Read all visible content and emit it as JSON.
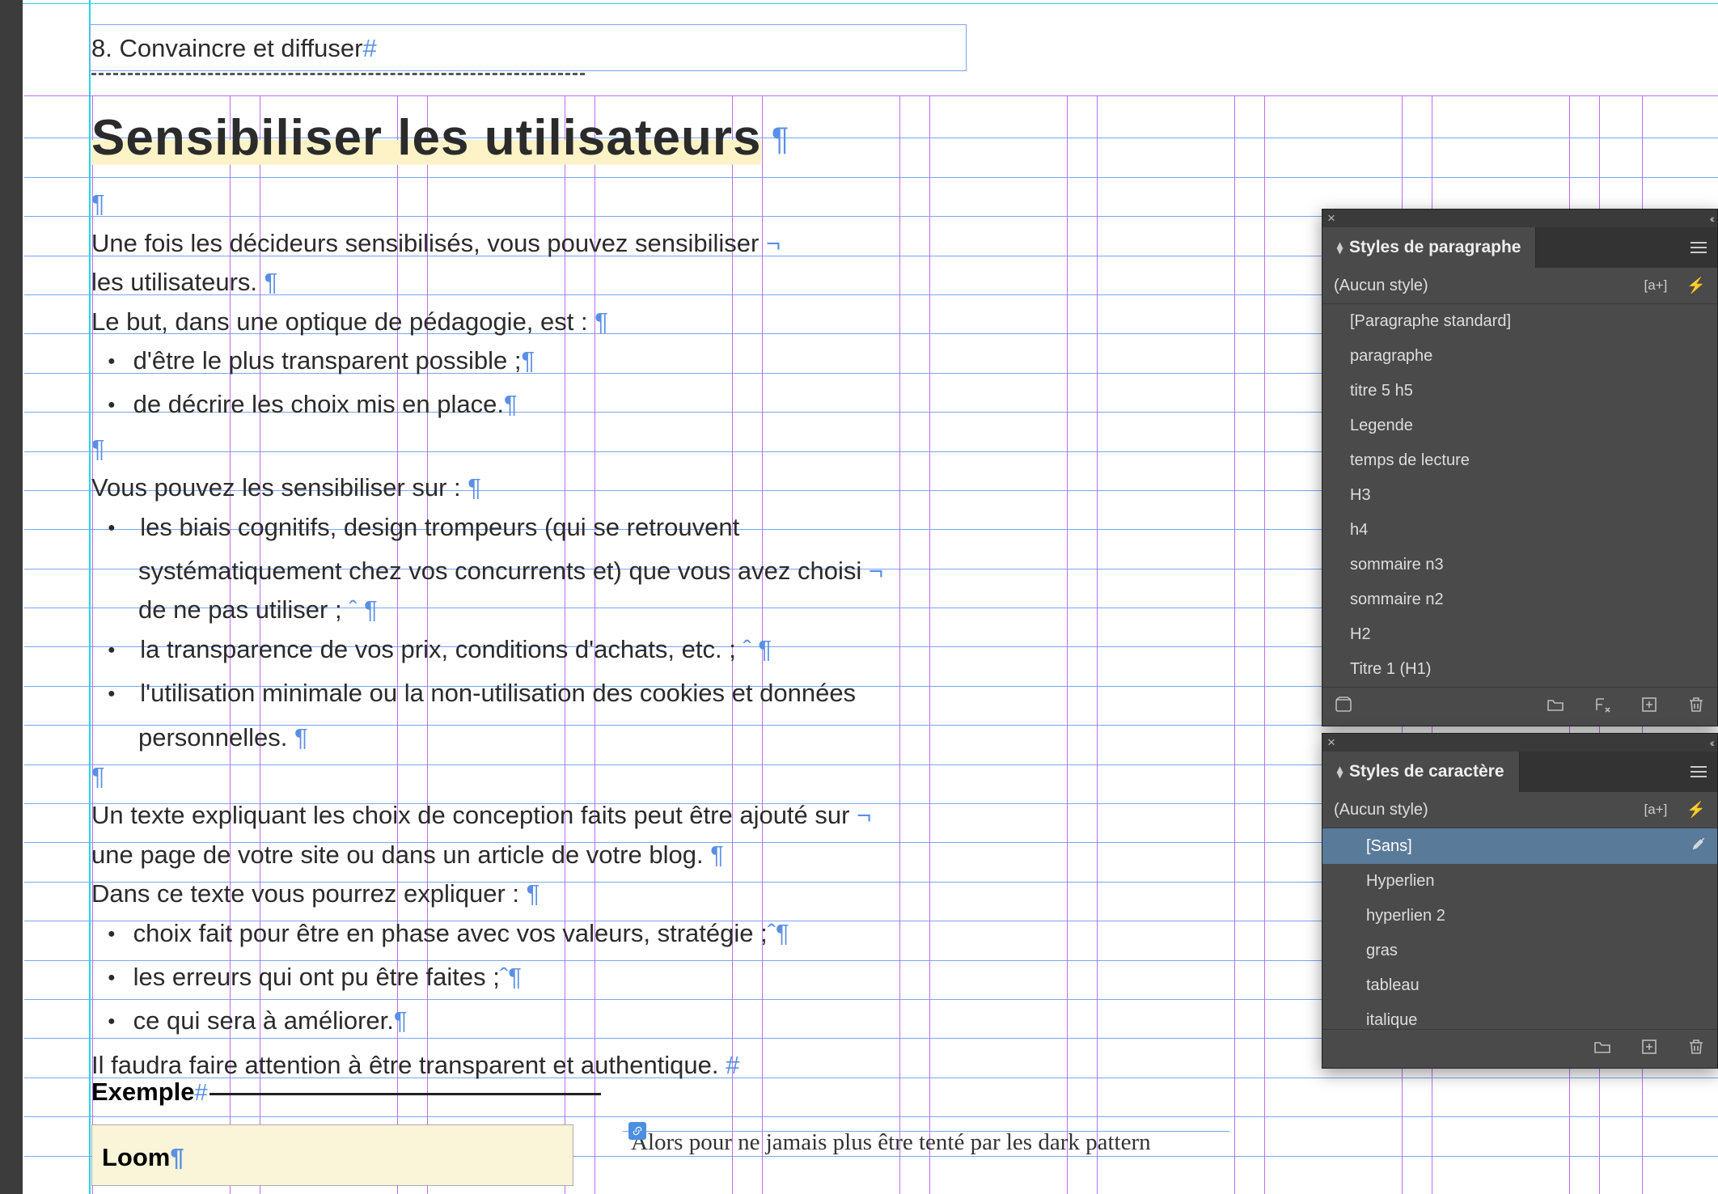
{
  "document": {
    "overline": "8. Convaincre et diffuser",
    "overline_marker": "#",
    "title": "Sensibiliser les utilisateurs",
    "title_marker": "¶",
    "para1_l1": "Une fois les décideurs sensibilisés, vous pouvez sensibiliser",
    "para1_l2": "les utilisateurs.",
    "para2": "Le but, dans une optique de pédagogie, est :",
    "list1": {
      "a": "d'être le plus transparent possible ;",
      "b": "de décrire les choix mis en place."
    },
    "para3": "Vous pouvez les sensibiliser sur :",
    "list2": {
      "a1": "les biais cognitifs, design trompeurs (qui se retrouvent",
      "a2": "systématiquement chez vos concurrents et) que vous avez choisi",
      "a3": "de ne pas utiliser ;",
      "b": "la transparence de vos prix, conditions d'achats, etc. ;",
      "c1": "l'utilisation minimale ou la non-utilisation des cookies et données",
      "c2": "personnelles."
    },
    "para4_l1": "Un texte expliquant les choix de conception faits peut être ajouté sur",
    "para4_l2": "une page de votre site ou dans un article de votre blog.",
    "para5": "Dans ce texte vous pourrez expliquer :",
    "list3": {
      "a": "choix fait pour être en phase avec vos valeurs, stratégie ;",
      "b": "les erreurs qui ont pu être faites ;",
      "c": "ce qui sera à améliorer."
    },
    "para6": "Il faudra faire attention à être transparent et authentique.",
    "exemple_label": "Exemple",
    "exemple_marker": "#",
    "loom": "Loom",
    "serif_line": "Alors pour ne jamais plus être tenté par les dark pattern",
    "pilcrow": "¶",
    "softreturn": "¬",
    "nbsp": "ˆ"
  },
  "panels": {
    "para": {
      "tab": "Styles de paragraphe",
      "current": "(Aucun style)",
      "items": [
        "[Paragraphe standard]",
        "paragraphe",
        "titre 5 h5",
        "Legende",
        "temps de lecture",
        "H3",
        "h4",
        "sommaire n3",
        "sommaire n2",
        "H2",
        "Titre 1 (H1)"
      ]
    },
    "char": {
      "tab": "Styles de caractère",
      "current": "(Aucun style)",
      "items": [
        "[Sans]",
        "Hyperlien",
        "hyperlien 2",
        "gras",
        "tableau",
        "italique"
      ],
      "selected_index": 0
    }
  }
}
